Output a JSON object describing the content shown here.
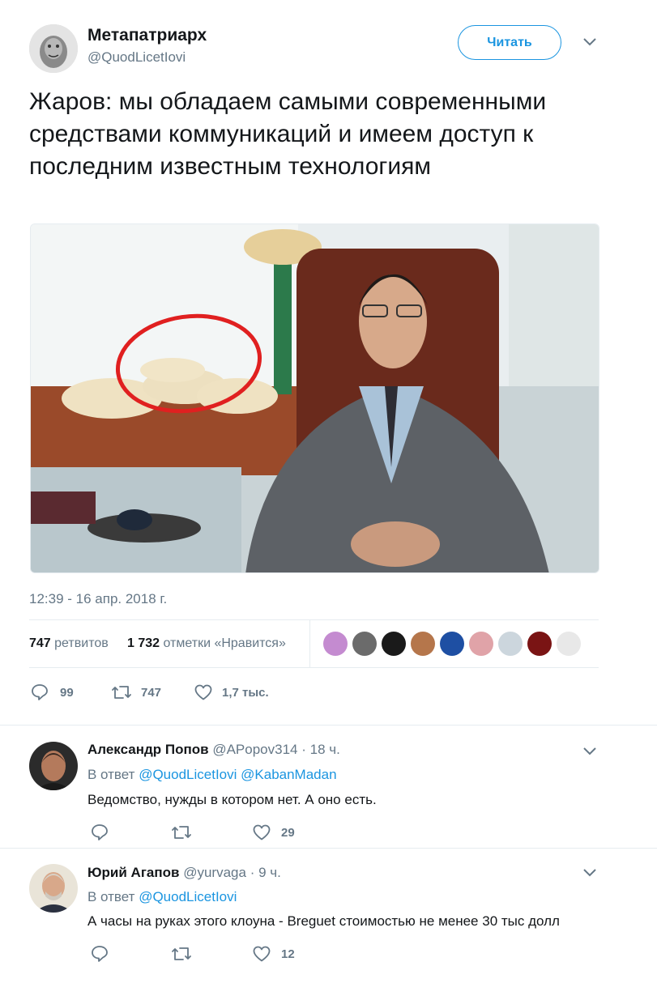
{
  "tweet": {
    "author_name": "Метапатриарх",
    "author_handle": "@QuodLicetIovi",
    "follow_label": "Читать",
    "text": "Жаров: мы обладаем самыми современными средствами коммуникаций и имеем доступ к последним известным технологиям",
    "timestamp": "12:39 - 16 апр. 2018 г.",
    "retweets_count": "747",
    "retweets_label": "ретвитов",
    "likes_count": "1 732",
    "likes_label": "отметки «Нравится»",
    "actions": {
      "replies": "99",
      "retweets": "747",
      "likes": "1,7 тыс."
    }
  },
  "replies": [
    {
      "name": "Александр Попов",
      "handle": "@APopov314",
      "time": "· 18 ч.",
      "reply_prefix": "В ответ",
      "reply_to_1": "@QuodLicetIovi",
      "reply_to_2": "@KabanMadan",
      "text": "Ведомство, нужды в котором нет. А оно есть.",
      "likes": "29"
    },
    {
      "name": "Юрий Агапов",
      "handle": "@yurvaga",
      "time": "· 9 ч.",
      "reply_prefix": "В ответ",
      "reply_to_1": "@QuodLicetIovi",
      "text": "А часы на руках этого клоуна - Breguet стоимостью не менее 30 тыс долл",
      "likes": "12"
    }
  ],
  "likers_avatar_colors": [
    "#c48bd0",
    "#6b6b6b",
    "#1a1a1a",
    "#b5764b",
    "#1e4fa3",
    "#e0a3a8",
    "#ccd6dd",
    "#7a1414",
    "#e8e8e8"
  ],
  "icons": [
    "chevron-down-icon",
    "reply-icon",
    "retweet-icon",
    "heart-icon"
  ],
  "colors": {
    "link": "#1b95e0",
    "muted": "#657786",
    "border": "#e6ecf0",
    "text": "#14171a",
    "circle_annotation": "#e02020"
  }
}
